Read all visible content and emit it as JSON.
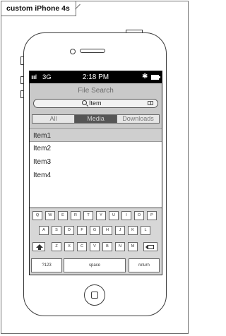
{
  "frame": {
    "label": "custom iPhone 4s"
  },
  "status_bar": {
    "signal": "ııııl",
    "carrier": "3G",
    "time": "2:18 PM",
    "bluetooth": "✱"
  },
  "header": {
    "title": "File Search"
  },
  "search": {
    "value": "Item"
  },
  "segments": [
    "All",
    "Media",
    "Downloads"
  ],
  "selected_segment": "Media",
  "list": [
    "Item1",
    "Item2",
    "Item3",
    "Item4"
  ],
  "keyboard": {
    "row1": [
      "Q",
      "W",
      "E",
      "R",
      "T",
      "Y",
      "U",
      "I",
      "O",
      "P"
    ],
    "row2": [
      "A",
      "S",
      "D",
      "F",
      "G",
      "H",
      "J",
      "K",
      "L"
    ],
    "row3": [
      "Z",
      "X",
      "C",
      "V",
      "B",
      "N",
      "M"
    ],
    "numbers": "?123",
    "space": "space",
    "return": "return"
  },
  "icons": [
    "search-icon",
    "book-icon",
    "bluetooth-icon",
    "battery-icon",
    "shift-icon",
    "backspace-icon",
    "home-icon"
  ]
}
